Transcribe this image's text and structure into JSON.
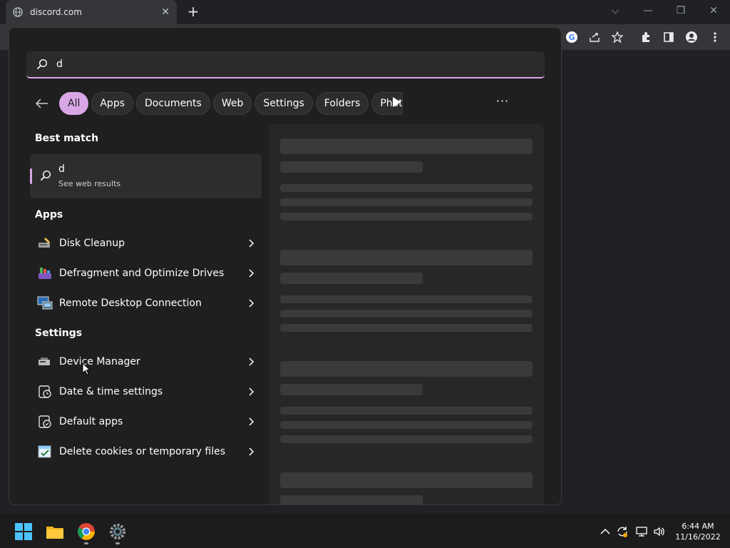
{
  "browser": {
    "tab_title": "discord.com",
    "tab_close": "✕",
    "new_tab": "+",
    "minimize": "—",
    "restore": "❐",
    "close": "✕",
    "dropdown": "⌵"
  },
  "search": {
    "query": "d"
  },
  "filters": [
    "All",
    "Apps",
    "Documents",
    "Web",
    "Settings",
    "Folders",
    "Phot"
  ],
  "more_label": "···",
  "best_match": {
    "heading": "Best match",
    "title": "d",
    "subtitle": "See web results"
  },
  "apps": {
    "heading": "Apps",
    "items": [
      "Disk Cleanup",
      "Defragment and Optimize Drives",
      "Remote Desktop Connection"
    ]
  },
  "settings": {
    "heading": "Settings",
    "items": [
      "Device Manager",
      "Date & time settings",
      "Default apps",
      "Delete cookies or temporary files"
    ]
  },
  "clock": {
    "time": "6:44 AM",
    "date": "11/16/2022"
  },
  "colors": {
    "accent": "#d9a7e6",
    "panel": "#1f1f1f",
    "skeleton": "#3a3a3a"
  }
}
